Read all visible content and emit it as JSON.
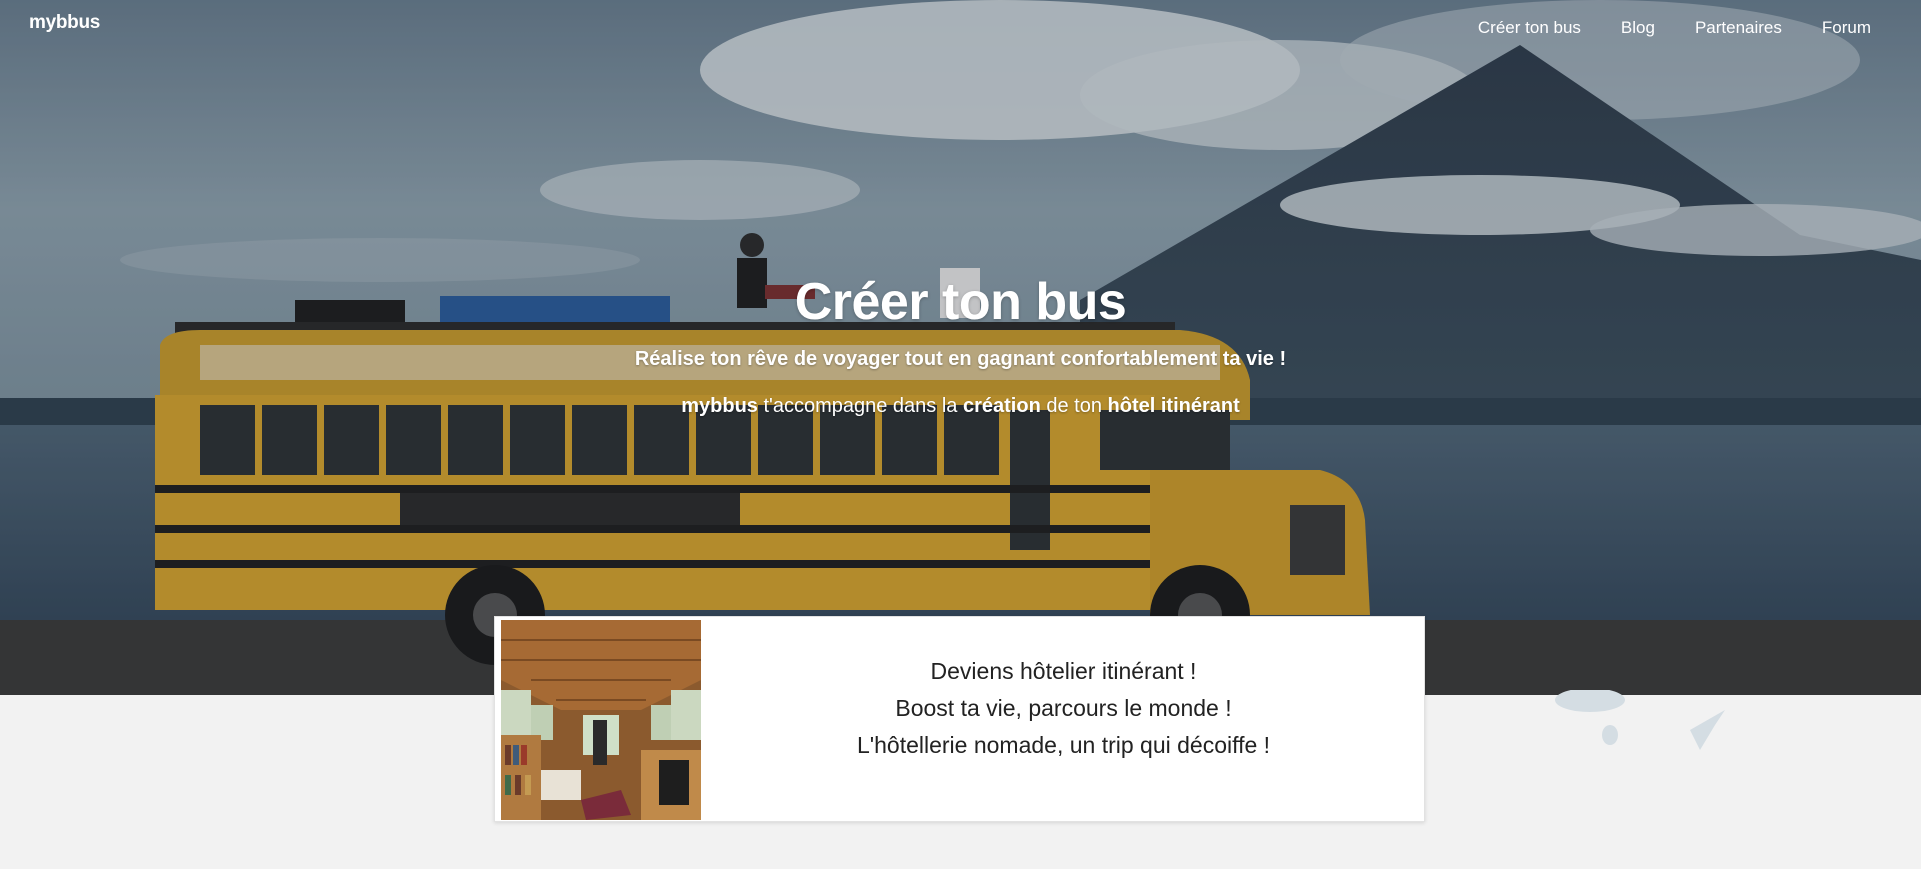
{
  "header": {
    "logo": "mybbus",
    "nav": [
      {
        "label": "Créer ton bus"
      },
      {
        "label": "Blog"
      },
      {
        "label": "Partenaires"
      },
      {
        "label": "Forum"
      }
    ]
  },
  "hero": {
    "title": "Créer ton bus",
    "subtitle": "Réalise ton rêve de voyager tout en gagnant confortablement ta vie !",
    "tagline": {
      "brand": "mybbus",
      "part1": " t'accompagne dans la ",
      "strong1": "création",
      "part2": " de ton ",
      "strong2": "hôtel itinérant"
    }
  },
  "card": {
    "lines": [
      "Deviens hôtelier itinérant !",
      "Boost ta vie, parcours le monde !",
      "L'hôtellerie nomade, un trip qui décoiffe !"
    ]
  },
  "colors": {
    "hero_text": "#ffffff",
    "background": "#f2f2f2",
    "card_bg": "#ffffff",
    "bus_yellow": "#d6a42e"
  }
}
